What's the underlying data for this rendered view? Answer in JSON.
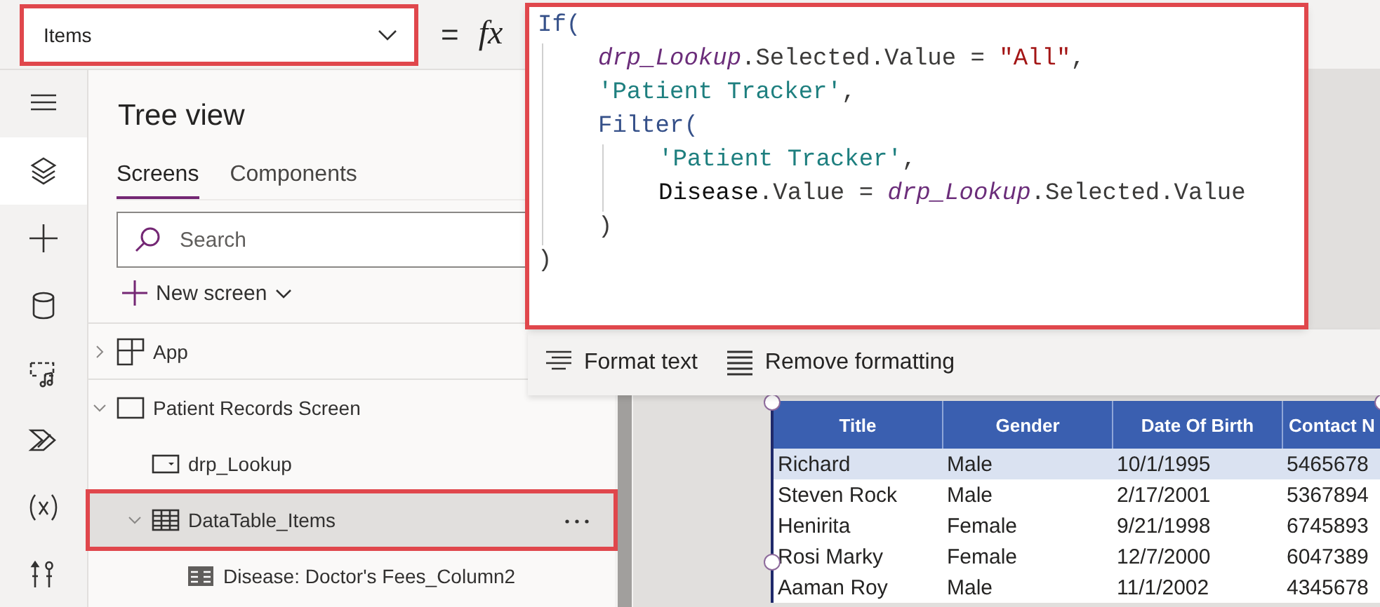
{
  "property_bar": {
    "property": "Items",
    "highlighted": true,
    "equals": "=",
    "formula_label": "fx"
  },
  "formula": {
    "highlighted": true,
    "lines": [
      {
        "tokens": [
          {
            "kind": "function",
            "text": "If("
          }
        ],
        "children": [
          {
            "tokens": [
              {
                "kind": "control",
                "text": "drp_Lookup"
              },
              {
                "kind": "plain",
                "text": ".Selected.Value = "
              },
              {
                "kind": "string",
                "text": "\"All\""
              },
              {
                "kind": "plain",
                "text": ","
              }
            ]
          },
          {
            "tokens": [
              {
                "kind": "table",
                "text": "'Patient Tracker'"
              },
              {
                "kind": "plain",
                "text": ","
              }
            ]
          },
          {
            "tokens": [
              {
                "kind": "function",
                "text": "Filter("
              }
            ],
            "children": [
              {
                "tokens": [
                  {
                    "kind": "table",
                    "text": "'Patient Tracker'"
                  },
                  {
                    "kind": "plain",
                    "text": ","
                  }
                ]
              },
              {
                "tokens": [
                  {
                    "kind": "field",
                    "text": "Disease"
                  },
                  {
                    "kind": "plain",
                    "text": ".Value = "
                  },
                  {
                    "kind": "control",
                    "text": "drp_Lookup"
                  },
                  {
                    "kind": "plain",
                    "text": ".Selected.Value"
                  }
                ]
              }
            ]
          },
          {
            "tokens": [
              {
                "kind": "plain",
                "text": ")"
              }
            ]
          }
        ]
      },
      {
        "tokens": [
          {
            "kind": "plain",
            "text": ")"
          }
        ]
      }
    ]
  },
  "format_toolbar": [
    {
      "kind": "format",
      "label": "Format text"
    },
    {
      "kind": "remove",
      "label": "Remove formatting"
    }
  ],
  "rail": [
    {
      "kind": "menu",
      "selected": false
    },
    {
      "kind": "layers",
      "selected": true
    },
    {
      "kind": "plus",
      "selected": false
    },
    {
      "kind": "database",
      "selected": false
    },
    {
      "kind": "media",
      "selected": false
    },
    {
      "kind": "automate",
      "selected": false
    },
    {
      "kind": "variables",
      "selected": false
    },
    {
      "kind": "tools",
      "selected": false
    }
  ],
  "tree_view": {
    "title": "Tree view",
    "tabs": [
      {
        "label": "Screens",
        "selected": true
      },
      {
        "label": "Components",
        "selected": false
      }
    ],
    "search": {
      "placeholder": "Search"
    },
    "new_screen": "New screen",
    "app": {
      "label": "App",
      "kind": "app",
      "expanded": false,
      "selected": false
    },
    "items": [
      {
        "label": "Patient Records Screen",
        "kind": "screen",
        "expanded": true,
        "selected": false,
        "children": [
          {
            "label": "drp_Lookup",
            "kind": "dropdown",
            "selected": false
          },
          {
            "label": "DataTable_Items",
            "kind": "datatable",
            "expanded": true,
            "selected": true,
            "highlighted": true,
            "children": [
              {
                "label": "Disease: Doctor's Fees_Column2",
                "kind": "column",
                "selected": false
              }
            ]
          }
        ]
      }
    ]
  },
  "table": {
    "columns": [
      "Title",
      "Gender",
      "Date Of Birth",
      "Contact N"
    ],
    "rows": [
      {
        "cells": [
          "Richard",
          "Male",
          "10/1/1995",
          "5465678"
        ],
        "selected": true
      },
      {
        "cells": [
          "Steven Rock",
          "Male",
          "2/17/2001",
          "5367894"
        ],
        "selected": false
      },
      {
        "cells": [
          "Henirita",
          "Female",
          "9/21/1998",
          "6745893"
        ],
        "selected": false
      },
      {
        "cells": [
          "Rosi Marky",
          "Female",
          "12/7/2000",
          "6047389"
        ],
        "selected": false
      },
      {
        "cells": [
          "Aaman Roy",
          "Male",
          "11/1/2002",
          "4345678"
        ],
        "selected": false
      }
    ]
  }
}
